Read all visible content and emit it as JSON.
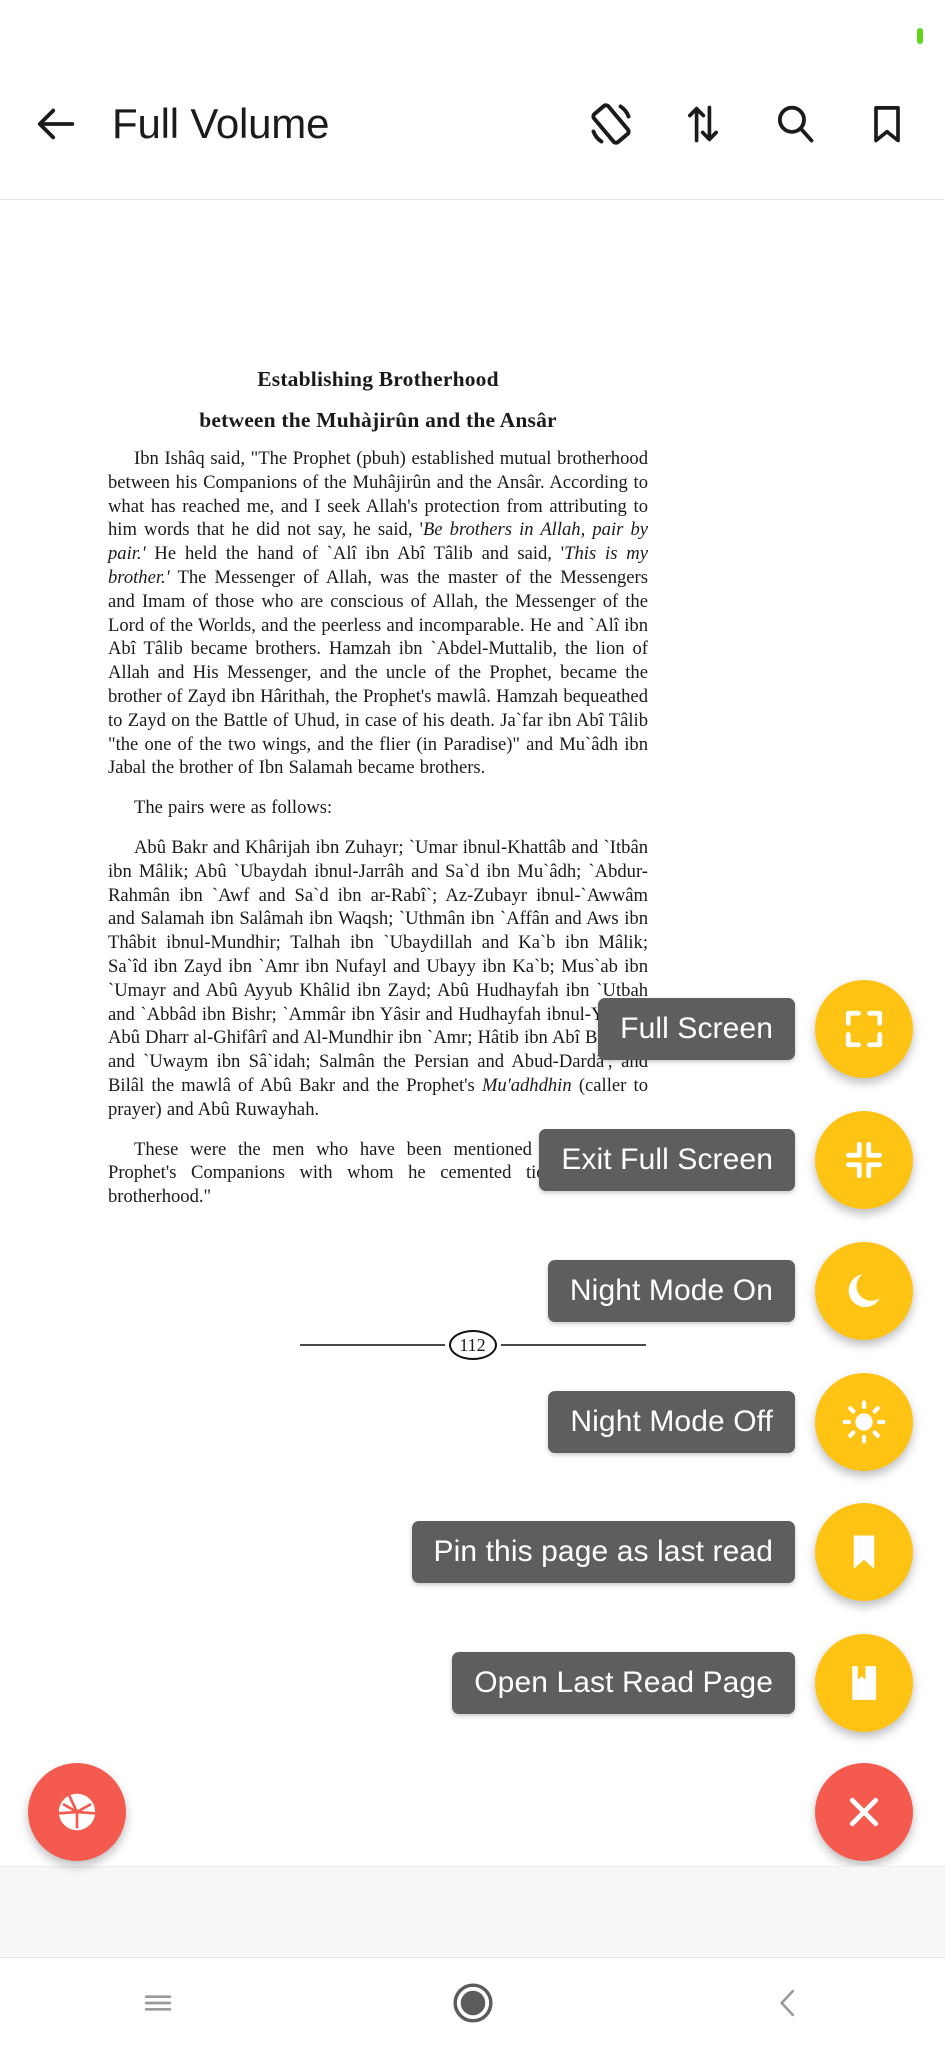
{
  "statusbar": {
    "indicator": "green-dot"
  },
  "appbar": {
    "back_icon": "arrow-left-icon",
    "title": "Full Volume",
    "actions": [
      {
        "icon": "screen-rotation-icon",
        "name": "rotate-screen-button"
      },
      {
        "icon": "swap-vertical-icon",
        "name": "scroll-direction-button"
      },
      {
        "icon": "search-icon",
        "name": "search-button"
      },
      {
        "icon": "bookmark-outline-icon",
        "name": "bookmark-button"
      }
    ]
  },
  "document": {
    "title_line1": "Establishing Brotherhood",
    "title_line2": "between the Muhàjirûn and the Ansâr",
    "paragraph1_a": "Ibn Ishâq said, \"The Prophet (pbuh) established mutual brotherhood between his Companions of the Muhâjirûn and the Ansâr. According to what has reached me, and I seek Allah's protection from attributing to him words that he did not say, he said, '",
    "paragraph1_italic1": "Be brothers in Allah, pair by pair.'",
    "paragraph1_b": " He held the hand of `Alî ibn Abî Tâlib and said, '",
    "paragraph1_italic2": "This is my brother.'",
    "paragraph1_c": " The Messenger of Allah, was the master of the Messengers and Imam of those who are conscious of Allah, the Messenger of the Lord of the Worlds, and the peerless and incomparable. He and `Alî ibn Abî Tâlib became brothers. Hamzah ibn `Abdel-Muttalib, the lion of Allah and His Messenger, and the uncle of the Prophet, became the brother of Zayd ibn Hârithah, the Prophet's mawlâ. Hamzah bequeathed to Zayd on the Battle of Uhud, in case of his death. Ja`far ibn Abî Tâlib \"the one of the two wings, and the flier (in Paradise)\" and Mu`âdh ibn Jabal the brother of Ibn Salamah became brothers.",
    "paragraph2": "The pairs were as follows:",
    "paragraph3_a": "Abû Bakr and Khârijah ibn Zuhayr; `Umar ibnul-Khattâb and `Itbân ibn Mâlik; Abû `Ubaydah ibnul-Jarrâh and Sa`d ibn Mu`âdh; `Abdur-Rahmân ibn `Awf and Sa`d ibn ar-Rabî`; Az-Zubayr ibnul-`Awwâm and Salamah ibn Salâmah ibn Waqsh; `Uthmân ibn `Affân and Aws ibn Thâbit ibnul-Mundhir; Talhah ibn `Ubaydillah and Ka`b ibn Mâlik; Sa`îd ibn Zayd ibn `Amr ibn Nufayl and Ubayy ibn Ka`b; Mus`ab ibn `Umayr and Abû Ayyub Khâlid ibn Zayd; Abû Hudhayfah ibn `Utbah and `Abbâd ibn Bishr; `Ammâr ibn Yâsir and Hudhayfah ibnul-Yamân; Abû Dharr al-Ghifârî and Al-Mundhir ibn `Amr; Hâtib ibn Abî Balta`ah and `Uwaym ibn Sâ`idah; Salmân the Persian and Abud-Dardâ'; and Bilâl the mawlâ of Abû Bakr and",
    "paragraph3_italic": "Mu'adhdhin",
    "paragraph3_b": " the Prophet's ",
    "paragraph3_c": " (caller to prayer) and Abû Ruwayhah.",
    "paragraph4": "These were the men who have been mentioned to us as the Prophet's Companions with whom he cemented ties of mutual brotherhood.\"",
    "page_number": "112"
  },
  "fab_menu": {
    "items": [
      {
        "tooltip": "Full Screen",
        "icon": "fullscreen-expand-icon",
        "color": "#FFC314",
        "name": "fab-full-screen"
      },
      {
        "tooltip": "Exit Full Screen",
        "icon": "fullscreen-exit-icon",
        "color": "#FFC314",
        "name": "fab-exit-full-screen"
      },
      {
        "tooltip": "Night Mode On",
        "icon": "moon-icon",
        "color": "#FFC314",
        "name": "fab-night-mode-on"
      },
      {
        "tooltip": "Night Mode Off",
        "icon": "sun-icon",
        "color": "#FFC314",
        "name": "fab-night-mode-off"
      },
      {
        "tooltip": "Pin this page as last read",
        "icon": "bookmark-filled-icon",
        "color": "#FFC314",
        "name": "fab-pin-page"
      },
      {
        "tooltip": "Open Last Read Page",
        "icon": "book-bookmark-icon",
        "color": "#FFC314",
        "name": "fab-open-last-read"
      }
    ],
    "close": {
      "icon": "close-x-icon",
      "color": "#F55A4E",
      "name": "fab-close-menu"
    },
    "camera": {
      "icon": "camera-aperture-icon",
      "color": "#F55A4E",
      "name": "fab-screenshot"
    }
  },
  "navbar": {
    "recents_icon": "menu-lines-icon",
    "home_icon": "home-circle-icon",
    "back_icon": "back-chevron-icon"
  }
}
